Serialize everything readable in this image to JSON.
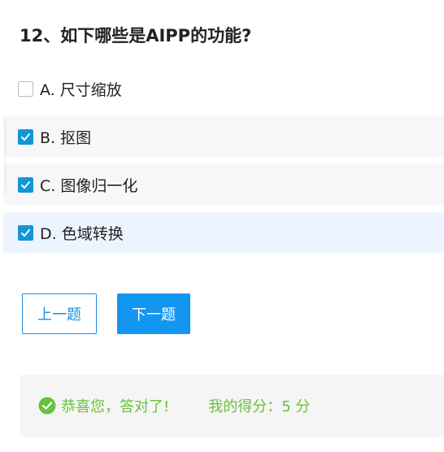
{
  "question": {
    "title": "12、如下哪些是AIPP的功能?"
  },
  "options": [
    {
      "label": "A. 尺寸缩放",
      "checked": false
    },
    {
      "label": "B. 抠图",
      "checked": true
    },
    {
      "label": "C. 图像归一化",
      "checked": true
    },
    {
      "label": "D. 色域转换",
      "checked": true
    }
  ],
  "buttons": {
    "prev_label": "上一题",
    "next_label": "下一题"
  },
  "result": {
    "message": "恭喜您，答对了!",
    "score": "我的得分：5 分",
    "icon": "check-circle-icon"
  },
  "colors": {
    "accent": "#1296f0",
    "success": "#67c23a",
    "selected_bg": "#ecf5ff"
  }
}
